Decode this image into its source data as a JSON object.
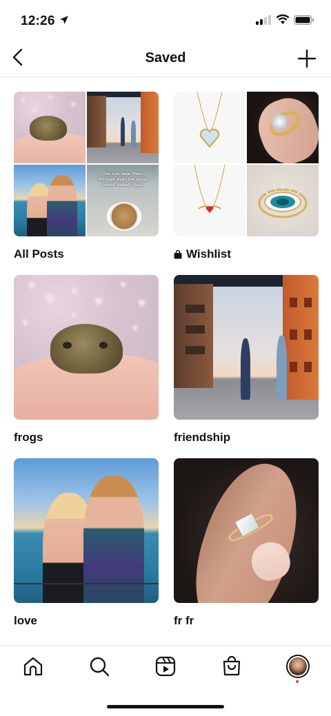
{
  "status_bar": {
    "time": "12:26",
    "icons": [
      "location-arrow-icon",
      "cellular-signal-icon",
      "wifi-icon",
      "battery-icon"
    ]
  },
  "header": {
    "title": "Saved",
    "back_icon": "chevron-left-icon",
    "add_icon": "plus-icon"
  },
  "collections": [
    {
      "label": "All Posts",
      "preview": "quad-mixed"
    },
    {
      "label": "Wishlist",
      "icon": "shopping-bag-icon",
      "preview": "quad-jewelry"
    },
    {
      "label": "frogs",
      "preview": "frog-on-hand"
    },
    {
      "label": "friendship",
      "preview": "two-friends-jumping"
    },
    {
      "label": "love",
      "preview": "couple-kiss-by-lake"
    },
    {
      "label": "fr fr",
      "preview": "ring-on-finger"
    }
  ],
  "tiktok_overlay_text": "You can wear them through even the most humid sweaty days",
  "bottom_nav": {
    "items": [
      "home-icon",
      "search-icon",
      "reels-icon",
      "shop-icon",
      "profile-avatar"
    ],
    "notification_color": "#ee2b4a"
  },
  "colors": {
    "background": "#ffffff",
    "text": "#111111",
    "divider": "#e6e6e6"
  }
}
